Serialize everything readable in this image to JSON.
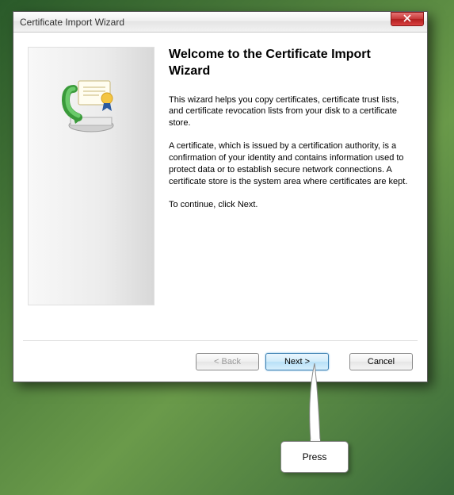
{
  "window": {
    "title": "Certificate Import Wizard"
  },
  "content": {
    "heading": "Welcome to the Certificate Import Wizard",
    "para1": "This wizard helps you copy certificates, certificate trust lists, and certificate revocation lists from your disk to a certificate store.",
    "para2": "A certificate, which is issued by a certification authority, is a confirmation of your identity and contains information used to protect data or to establish secure network connections. A certificate store is the system area where certificates are kept.",
    "para3": "To continue, click Next."
  },
  "buttons": {
    "back": "< Back",
    "next": "Next >",
    "cancel": "Cancel"
  },
  "callout": {
    "label": "Press"
  }
}
